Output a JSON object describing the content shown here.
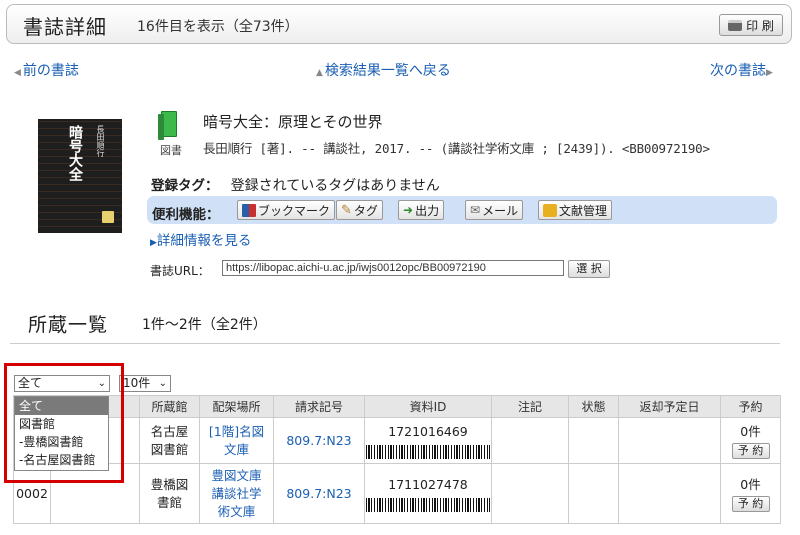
{
  "header": {
    "title": "書誌詳細",
    "subtitle": "16件目を表示（全73件）",
    "print_label": "印 刷"
  },
  "nav": {
    "prev": "前の書誌",
    "back": "検索結果一覧へ戻る",
    "next": "次の書誌"
  },
  "book": {
    "cover_title": "暗号大全",
    "cover_author": "長田順行",
    "media_label": "図書",
    "title": "暗号大全：原理とその世界",
    "biblio": "長田順行 [著]. -- 講談社, 2017. -- (講談社学術文庫 ; [2439]). <BB00972190>",
    "tags_label": "登録タグ：",
    "tags_value": "登録されているタグはありません",
    "tools_label": "便利機能：",
    "tools": {
      "bookmark": "ブックマーク",
      "tag": "タグ",
      "output": "出力",
      "mail": "メール",
      "refmgr": "文献管理"
    },
    "detail_link": "詳細情報を見る",
    "url_label": "書誌URL：",
    "url": "https://libopac.aichi-u.ac.jp/iwjs0012opc/BB00972190",
    "select_label": "選 択",
    "colors": {
      "toolbar": "#cfe0f7",
      "link": "#1a5fb4",
      "highlight": "#d40000"
    }
  },
  "holdings": {
    "title": "所蔵一覧",
    "count": "1件〜2件（全2件）",
    "filter_value": "全て",
    "per_page": "10件",
    "filter_options": [
      "全て",
      "図書館",
      "-豊橋図書館",
      "-名古屋図書館"
    ],
    "columns": [
      "",
      "",
      "所蔵館",
      "配架場所",
      "請求記号",
      "資料ID",
      "注記",
      "状態",
      "返却予定日",
      "予約"
    ],
    "rows": [
      {
        "num": "",
        "library": "名古屋図書館",
        "location": "[1階]名図文庫",
        "call": "809.7:N23",
        "id": "1721016469",
        "note": "",
        "status": "",
        "due": "",
        "reserve_count": "0件",
        "reserve_btn": "予 約"
      },
      {
        "num": "0002",
        "library": "豊橋図書館",
        "location": "豊図文庫講談社学術文庫",
        "call": "809.7:N23",
        "id": "1711027478",
        "note": "",
        "status": "",
        "due": "",
        "reserve_count": "0件",
        "reserve_btn": "予 約"
      }
    ]
  }
}
